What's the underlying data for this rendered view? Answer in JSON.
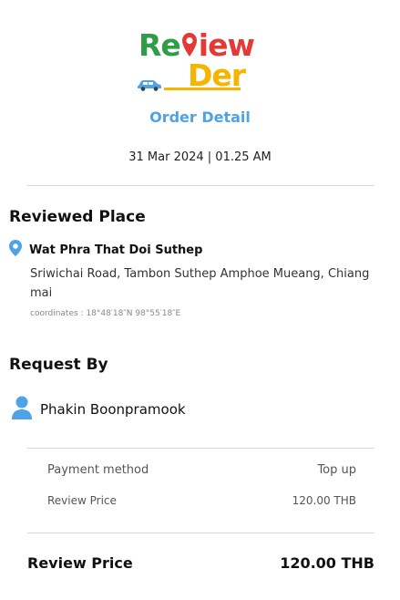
{
  "logo": {
    "part_re": "Re",
    "part_iew": "iew",
    "part_der": "Der",
    "colors": {
      "green": "#2f9d48",
      "red": "#e53935",
      "yellow": "#f5b400",
      "blue": "#4da3e6"
    }
  },
  "header": {
    "title": "Order Detail",
    "datetime": "31 Mar 2024 | 01.25 AM"
  },
  "reviewed_place": {
    "section_title": "Reviewed Place",
    "name": "Wat Phra That Doi Suthep",
    "address": "Sriwichai Road, Tambon Suthep Amphoe Mueang, Chiang mai",
    "coordinates": "coordinates : 18°48′18″N 98°55′18″E"
  },
  "request_by": {
    "section_title": "Request By",
    "user_name": "Phakin Boonpramook"
  },
  "payment": {
    "method_label": "Payment method",
    "method_value": "Top up",
    "price_label": "Review Price",
    "price_value": "120.00 THB"
  },
  "total": {
    "label": "Review Price",
    "value": "120.00 THB"
  }
}
